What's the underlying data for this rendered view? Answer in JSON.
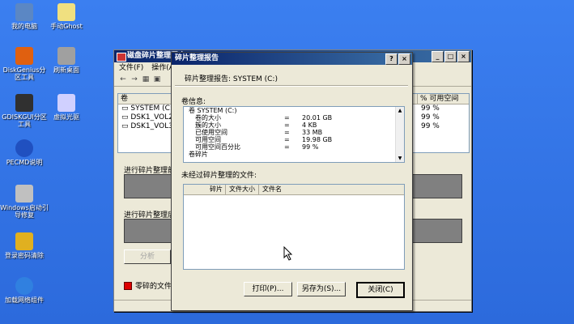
{
  "desktop": {
    "icons": [
      {
        "label": "我的电脑",
        "color": "#5b87c4"
      },
      {
        "label": "DiskGenius分区工具",
        "color": "#e06010"
      },
      {
        "label": "GDISKGUI分区工具",
        "color": "#303030"
      },
      {
        "label": "PECMD说明",
        "color": "#2050c0"
      },
      {
        "label": "Windows启动引导修复",
        "color": "#c0c0c0"
      },
      {
        "label": "登录密码清除",
        "color": "#e0b020"
      },
      {
        "label": "加载网络组件",
        "color": "#3080e0"
      }
    ],
    "icons2": [
      {
        "label": "手动Ghost",
        "color": "#f0e080"
      },
      {
        "label": "刷新桌面",
        "color": "#a0a0a0"
      },
      {
        "label": "虚拟光驱",
        "color": "#d0d0ff"
      }
    ]
  },
  "main_window": {
    "title": "磁盘碎片整理程序",
    "menu": [
      "文件(F)",
      "操作(A)"
    ],
    "volume_header": {
      "name": "卷",
      "pct": "% 可用空间"
    },
    "volumes": [
      {
        "name": "SYSTEM (C:)",
        "pct": "99 %"
      },
      {
        "name": "DSK1_VOL2 (D:)",
        "pct": "99 %"
      },
      {
        "name": "DSK1_VOL3 (E:)",
        "pct": "99 %"
      }
    ],
    "section_before": "进行碎片整理前",
    "section_after": "进行碎片整理后",
    "analyze_label": "分析",
    "legend_label": "零碎的文件"
  },
  "dialog": {
    "title": "碎片整理报告",
    "header": "碎片整理报告: SYSTEM (C:)",
    "info_label": "卷信息:",
    "info_rows": [
      {
        "k": "卷 SYSTEM (C:)",
        "eq": "",
        "v": "",
        "indent": false
      },
      {
        "k": "卷的大小",
        "eq": "=",
        "v": "20.01 GB",
        "indent": true
      },
      {
        "k": "簇的大小",
        "eq": "=",
        "v": "4 KB",
        "indent": true
      },
      {
        "k": "已使用空间",
        "eq": "=",
        "v": "33 MB",
        "indent": true
      },
      {
        "k": "可用空间",
        "eq": "=",
        "v": "19.98 GB",
        "indent": true
      },
      {
        "k": "可用空间百分比",
        "eq": "=",
        "v": "99 %",
        "indent": true
      },
      {
        "k": "卷碎片",
        "eq": "",
        "v": "",
        "indent": false
      }
    ],
    "files_label": "未经过碎片整理的文件:",
    "file_columns": [
      "碎片",
      "文件大小",
      "文件名"
    ],
    "print_label": "打印(P)...",
    "saveas_label": "另存为(S)...",
    "close_label": "关闭(C)"
  }
}
